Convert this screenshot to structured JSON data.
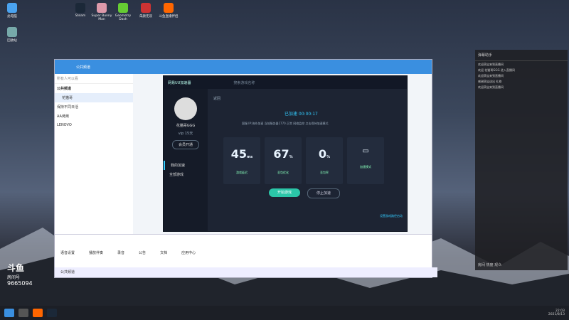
{
  "desktop_icons": [
    {
      "label": "此电脑"
    },
    {
      "label": "回收站"
    },
    {
      "label": "Steam"
    },
    {
      "label": "Super Bunny Man"
    },
    {
      "label": "Geometry Dash"
    },
    {
      "label": "朱颜无双"
    },
    {
      "label": "斗鱼直播伴侣"
    }
  ],
  "chat": {
    "title": "公共频道",
    "search_placeholder": "所有人可以看",
    "channel_group": "公共频道",
    "channel_item": "花猫哥",
    "list": [
      "保持不同日活",
      "AA烤烤",
      "LENOVO"
    ],
    "toolbar": [
      "语音设置",
      "播放伴奏",
      "录音"
    ],
    "bottom_bar": [
      "公告",
      "文档",
      "应用中心"
    ],
    "tab": "公共频道"
  },
  "booster": {
    "title": "网易UU加速器",
    "search_placeholder": "搜索游戏名称",
    "username": "花猫哥GGG",
    "vip": "vip 15天",
    "member_button": "会员开通",
    "nav": [
      "我的加速",
      "全部游戏"
    ],
    "back": "返回",
    "status": "已加速 00:00:17",
    "route": "国服 IP:海外加速 当前服务器1770 正常 网络监控 点击保持加速模式",
    "stats": [
      {
        "value": "45",
        "unit": "ms",
        "label": "游戏延迟"
      },
      {
        "value": "67",
        "unit": "%",
        "label": "丢包优化"
      },
      {
        "value": "0",
        "unit": "%",
        "label": "丢包率"
      },
      {
        "value": "",
        "unit": "",
        "label": "加速模式"
      }
    ],
    "start_button": "开始游戏",
    "stop_button": "停止加速",
    "footer_link": "设置游戏路径启动"
  },
  "right_panel": {
    "header": "弹幕助手",
    "lines": [
      "欢迎萌宝来到直播间",
      "欢迎 花猫哥GGG 进入直播间",
      "欢迎萌宝来到直播间",
      "感谢萌宝送出 礼物",
      "欢迎萌宝来到直播间"
    ],
    "footer": "房间 热度 观众"
  },
  "douyu": {
    "brand": "斗鱼",
    "room_label": "房间号",
    "room": "9665094"
  },
  "taskbar": {
    "time": "22:03",
    "date": "2021/8/13"
  }
}
